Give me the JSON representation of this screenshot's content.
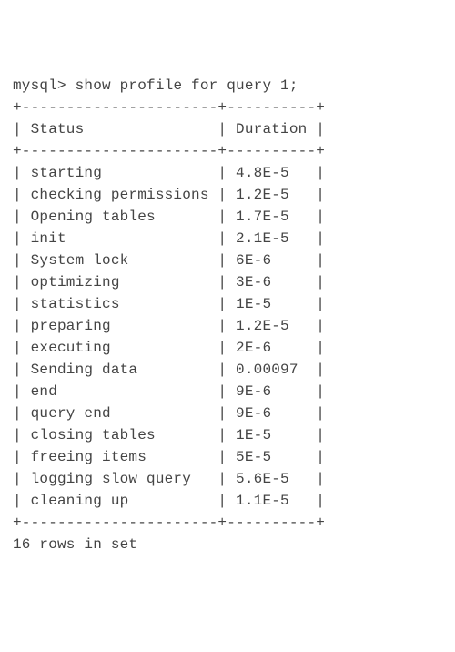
{
  "prompt": "mysql> ",
  "command": "show profile for query 1;",
  "headers": {
    "status": "Status",
    "duration": "Duration"
  },
  "rows": [
    {
      "status": "starting",
      "duration": "4.8E-5"
    },
    {
      "status": "checking permissions",
      "duration": "1.2E-5"
    },
    {
      "status": "Opening tables",
      "duration": "1.7E-5"
    },
    {
      "status": "init",
      "duration": "2.1E-5"
    },
    {
      "status": "System lock",
      "duration": "6E-6"
    },
    {
      "status": "optimizing",
      "duration": "3E-6"
    },
    {
      "status": "statistics",
      "duration": "1E-5"
    },
    {
      "status": "preparing",
      "duration": "1.2E-5"
    },
    {
      "status": "executing",
      "duration": "2E-6"
    },
    {
      "status": "Sending data",
      "duration": "0.00097"
    },
    {
      "status": "end",
      "duration": "9E-6"
    },
    {
      "status": "query end",
      "duration": "9E-6"
    },
    {
      "status": "closing tables",
      "duration": "1E-5"
    },
    {
      "status": "freeing items",
      "duration": "5E-5"
    },
    {
      "status": "logging slow query",
      "duration": "5.6E-5"
    },
    {
      "status": "cleaning up",
      "duration": "1.1E-5"
    }
  ],
  "footer": "16 rows in set",
  "chart_data": {
    "type": "table",
    "title": "show profile for query 1",
    "columns": [
      "Status",
      "Duration"
    ],
    "data": [
      [
        "starting",
        4.8e-05
      ],
      [
        "checking permissions",
        1.2e-05
      ],
      [
        "Opening tables",
        1.7e-05
      ],
      [
        "init",
        2.1e-05
      ],
      [
        "System lock",
        6e-06
      ],
      [
        "optimizing",
        3e-06
      ],
      [
        "statistics",
        1e-05
      ],
      [
        "preparing",
        1.2e-05
      ],
      [
        "executing",
        2e-06
      ],
      [
        "Sending data",
        0.00097
      ],
      [
        "end",
        9e-06
      ],
      [
        "query end",
        9e-06
      ],
      [
        "closing tables",
        1e-05
      ],
      [
        "freeing items",
        5e-05
      ],
      [
        "logging slow query",
        5.6e-05
      ],
      [
        "cleaning up",
        1.1e-05
      ]
    ]
  },
  "widths": {
    "status": 21,
    "duration": 9
  }
}
